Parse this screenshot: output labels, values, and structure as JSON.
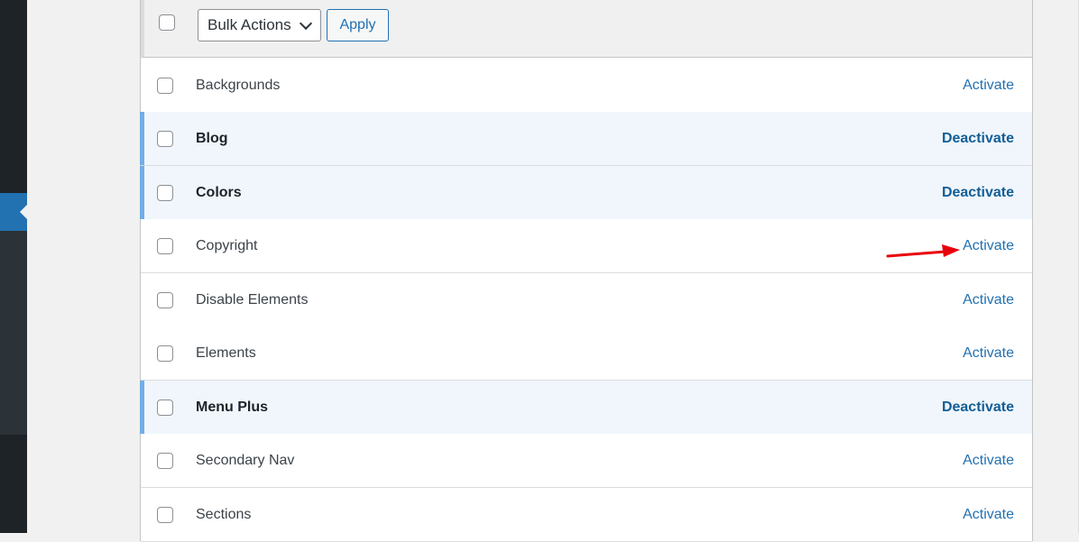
{
  "bulk_bar": {
    "bulk_actions_value": "Bulk Actions",
    "apply_label": "Apply"
  },
  "modules": [
    {
      "name": "Backgrounds",
      "action": "Activate",
      "active": false
    },
    {
      "name": "Blog",
      "action": "Deactivate",
      "active": true
    },
    {
      "name": "Colors",
      "action": "Deactivate",
      "active": true
    },
    {
      "name": "Copyright",
      "action": "Activate",
      "active": false
    },
    {
      "name": "Disable Elements",
      "action": "Activate",
      "active": false
    },
    {
      "name": "Elements",
      "action": "Activate",
      "active": false
    },
    {
      "name": "Menu Plus",
      "action": "Deactivate",
      "active": true
    },
    {
      "name": "Secondary Nav",
      "action": "Activate",
      "active": false
    },
    {
      "name": "Sections",
      "action": "Activate",
      "active": false
    }
  ],
  "colors": {
    "link": "#2271b1",
    "active_row_border": "#72aee6",
    "active_row_bg": "#f0f6fc",
    "annotation_arrow": "#e8000b"
  }
}
